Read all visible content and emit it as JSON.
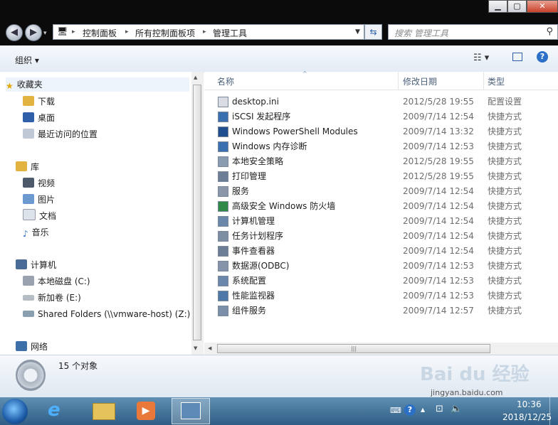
{
  "address": {
    "crumbs": [
      "控制面板",
      "所有控制面板项",
      "管理工具"
    ]
  },
  "search": {
    "placeholder": "搜索 管理工具"
  },
  "toolbar": {
    "organize_label": "组织 ▾"
  },
  "nav": {
    "favorites": "收藏夹",
    "downloads": "下载",
    "desktop": "桌面",
    "recent": "最近访问的位置",
    "libraries": "库",
    "videos": "视频",
    "pictures": "图片",
    "documents": "文档",
    "music": "音乐",
    "computer": "计算机",
    "local_disk": "本地磁盘 (C:)",
    "new_volume": "新加卷 (E:)",
    "shared": "Shared Folders (\\\\vmware-host) (Z:)",
    "network": "网络"
  },
  "columns": {
    "name": "名称",
    "date": "修改日期",
    "type": "类型"
  },
  "files": [
    {
      "name": "desktop.ini",
      "date": "2012/5/28 19:55",
      "type": "配置设置"
    },
    {
      "name": "iSCSI 发起程序",
      "date": "2009/7/14 12:54",
      "type": "快捷方式"
    },
    {
      "name": "Windows PowerShell Modules",
      "date": "2009/7/14 13:32",
      "type": "快捷方式"
    },
    {
      "name": "Windows 内存诊断",
      "date": "2009/7/14 12:53",
      "type": "快捷方式"
    },
    {
      "name": "本地安全策略",
      "date": "2012/5/28 19:55",
      "type": "快捷方式"
    },
    {
      "name": "打印管理",
      "date": "2012/5/28 19:55",
      "type": "快捷方式"
    },
    {
      "name": "服务",
      "date": "2009/7/14 12:54",
      "type": "快捷方式"
    },
    {
      "name": "高级安全 Windows 防火墙",
      "date": "2009/7/14 12:54",
      "type": "快捷方式"
    },
    {
      "name": "计算机管理",
      "date": "2009/7/14 12:54",
      "type": "快捷方式"
    },
    {
      "name": "任务计划程序",
      "date": "2009/7/14 12:54",
      "type": "快捷方式"
    },
    {
      "name": "事件查看器",
      "date": "2009/7/14 12:54",
      "type": "快捷方式"
    },
    {
      "name": "数据源(ODBC)",
      "date": "2009/7/14 12:53",
      "type": "快捷方式"
    },
    {
      "name": "系统配置",
      "date": "2009/7/14 12:53",
      "type": "快捷方式"
    },
    {
      "name": "性能监视器",
      "date": "2009/7/14 12:53",
      "type": "快捷方式"
    },
    {
      "name": "组件服务",
      "date": "2009/7/14 12:57",
      "type": "快捷方式"
    }
  ],
  "status": {
    "count": "15 个对象"
  },
  "taskbar": {
    "time": "10:36",
    "date": "2018/12/25"
  },
  "watermark": {
    "text": "Bai du 经验",
    "url": "jingyan.baidu.com"
  },
  "colors": {
    "accent": "#2c5ea8",
    "taskbar": "#3d6a91"
  }
}
